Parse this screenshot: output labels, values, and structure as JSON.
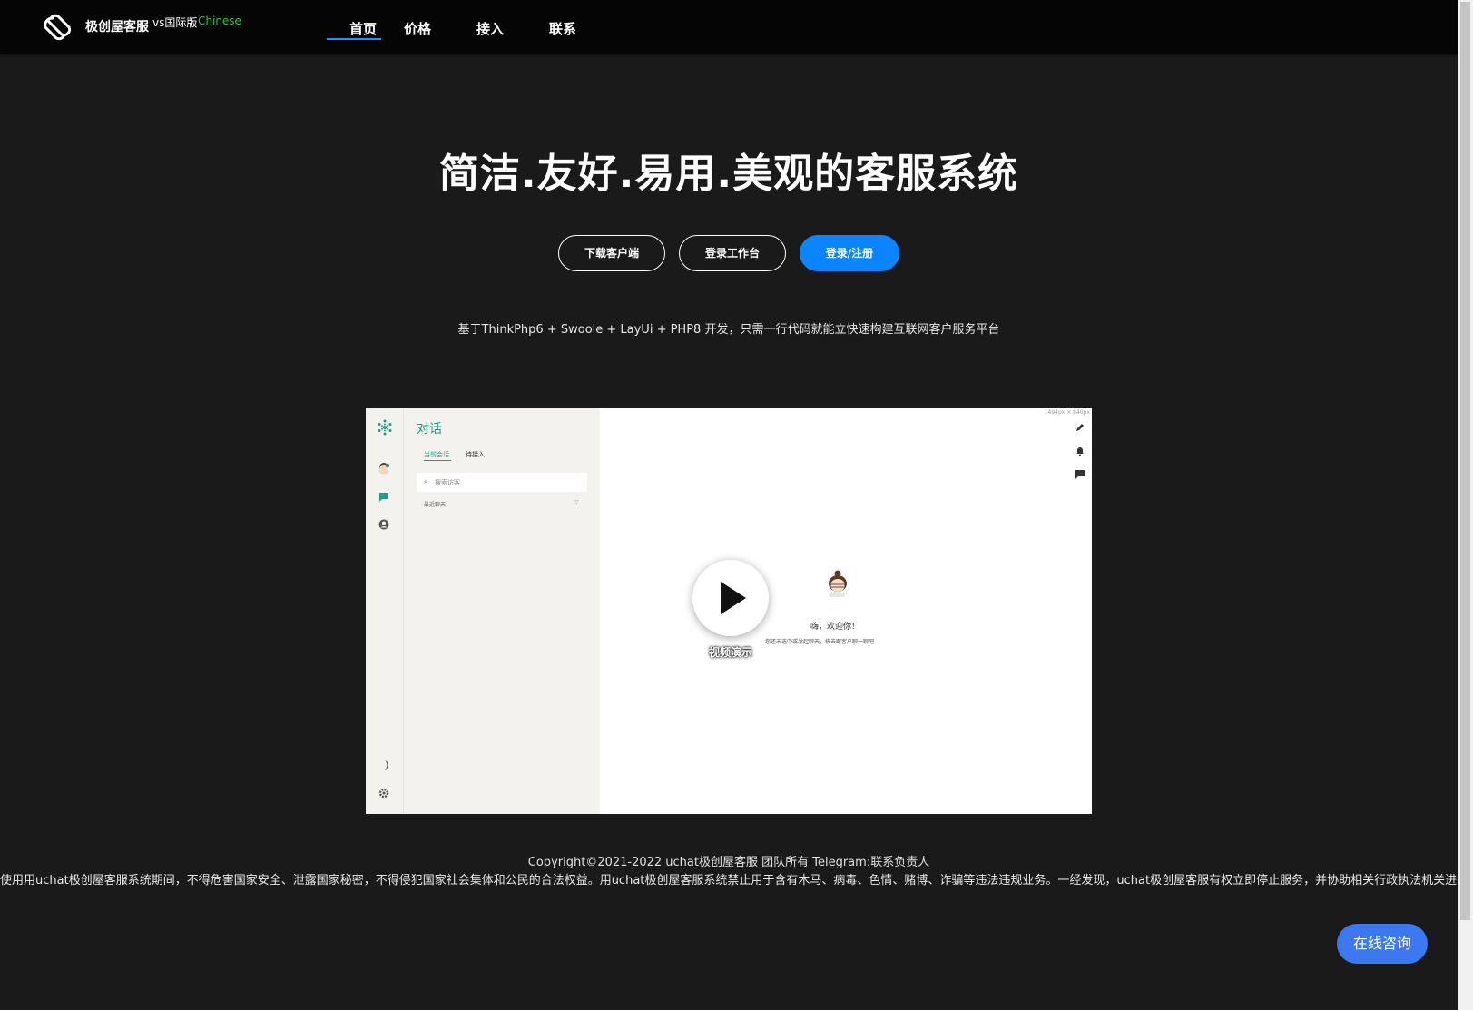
{
  "header": {
    "brand": "极创屋客服",
    "edition_prefix": "vs",
    "edition": "国际版",
    "language": "Chinese",
    "nav": [
      {
        "label": "首页",
        "active": true
      },
      {
        "label": "价格"
      },
      {
        "label": "接入"
      },
      {
        "label": "联系"
      }
    ]
  },
  "hero": {
    "title": "简洁.友好.易用.美观的客服系统",
    "buttons": {
      "download": "下载客户端",
      "console": "登录工作台",
      "login": "登录/注册"
    },
    "subtitle": "基于ThinkPhp6 + Swoole + LayUi + PHP8 开发，只需一行代码就能立快速构建互联网客户服务平台"
  },
  "preview": {
    "title": "对话",
    "tab_current": "当前会话",
    "tab_waiting": "待接入",
    "search_placeholder": "搜索访客",
    "recent_label": "最近聊天",
    "dimensions": "1494px × 840px",
    "welcome": "嗨，欢迎你！",
    "welcome_sub": "您还未选中或发起聊天，快去跟客户聊一聊吧",
    "play_label": "视频演示"
  },
  "footer": {
    "copyright": "Copyright©2021-2022 uchat极创屋客服 团队所有 Telegram:联系负责人",
    "notice": "使用用uchat极创屋客服系统期间，不得危害国家安全、泄露国家秘密，不得侵犯国家社会集体和公民的合法权益。用uchat极创屋客服系统禁止用于含有木马、病毒、色情、赌博、诈骗等违法违规业务。一经发现，uchat极创屋客服有权立即停止服务，并协助相关行政执法机关进行清查"
  },
  "consult_button": "在线咨询",
  "colors": {
    "background": "#1a1a1a",
    "header": "#050505",
    "accent": "#0a84ff",
    "nav_underline": "#1e90ff",
    "language_green": "#28c840",
    "preview_green": "#1aa08a",
    "consult": "#3c78f0"
  }
}
